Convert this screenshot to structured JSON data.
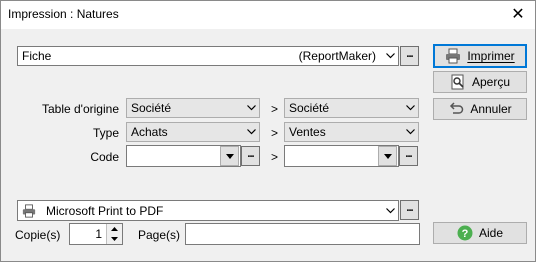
{
  "window": {
    "title": "Impression : Natures",
    "close_glyph": "✕"
  },
  "report": {
    "value": "Fiche",
    "engine": "(ReportMaker)"
  },
  "buttons": {
    "print": "Imprimer",
    "preview": "Aperçu",
    "cancel": "Annuler",
    "help": "Aide",
    "dots": "..."
  },
  "filters": {
    "origin_table": {
      "label": "Table d'origine",
      "from": "Société",
      "to": "Société"
    },
    "type": {
      "label": "Type",
      "from": "Achats",
      "to": "Ventes"
    },
    "code": {
      "label": "Code",
      "from": "",
      "to": ""
    },
    "range_sep": ">"
  },
  "printer": {
    "name": "Microsoft Print to PDF"
  },
  "copies": {
    "label": "Copie(s)",
    "value": "1"
  },
  "pages": {
    "label": "Page(s)",
    "value": ""
  },
  "colors": {
    "default_button_border": "#0078d7",
    "help_icon": "#4caf50"
  }
}
